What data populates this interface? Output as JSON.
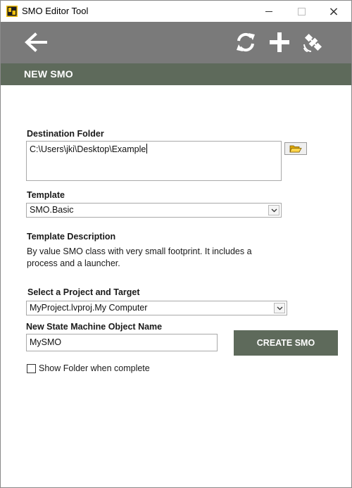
{
  "window": {
    "title": "SMO Editor Tool",
    "app_icon": "labview-icon",
    "controls": {
      "minimize": "minimize-icon",
      "maximize": "maximize-icon",
      "close": "×"
    }
  },
  "toolbar": {
    "back_icon": "arrow-left-icon",
    "refresh_icon": "refresh-icon",
    "add_icon": "plus-icon",
    "link_icon": "satellite-icon"
  },
  "header": {
    "title": "NEW SMO"
  },
  "form": {
    "destination_label": "Destination Folder",
    "destination_value": "C:\\Users\\jki\\Desktop\\Example",
    "folder_button_icon": "folder-open-icon",
    "template_label": "Template",
    "template_value": "SMO.Basic",
    "template_description_label": "Template Description",
    "template_description_line1": "By value SMO class with very small footprint. It includes a",
    "template_description_line2": "process and a launcher.",
    "project_label": "Select a Project and Target",
    "project_value": "MyProject.lvproj.My Computer",
    "name_label": "New State Machine Object Name",
    "name_value": "MySMO",
    "create_button": "CREATE SMO",
    "show_folder_label": "Show Folder when complete",
    "show_folder_checked": false
  },
  "colors": {
    "toolbar": "#7a7a7a",
    "header": "#5e6a5b",
    "button": "#5e6a5b"
  }
}
